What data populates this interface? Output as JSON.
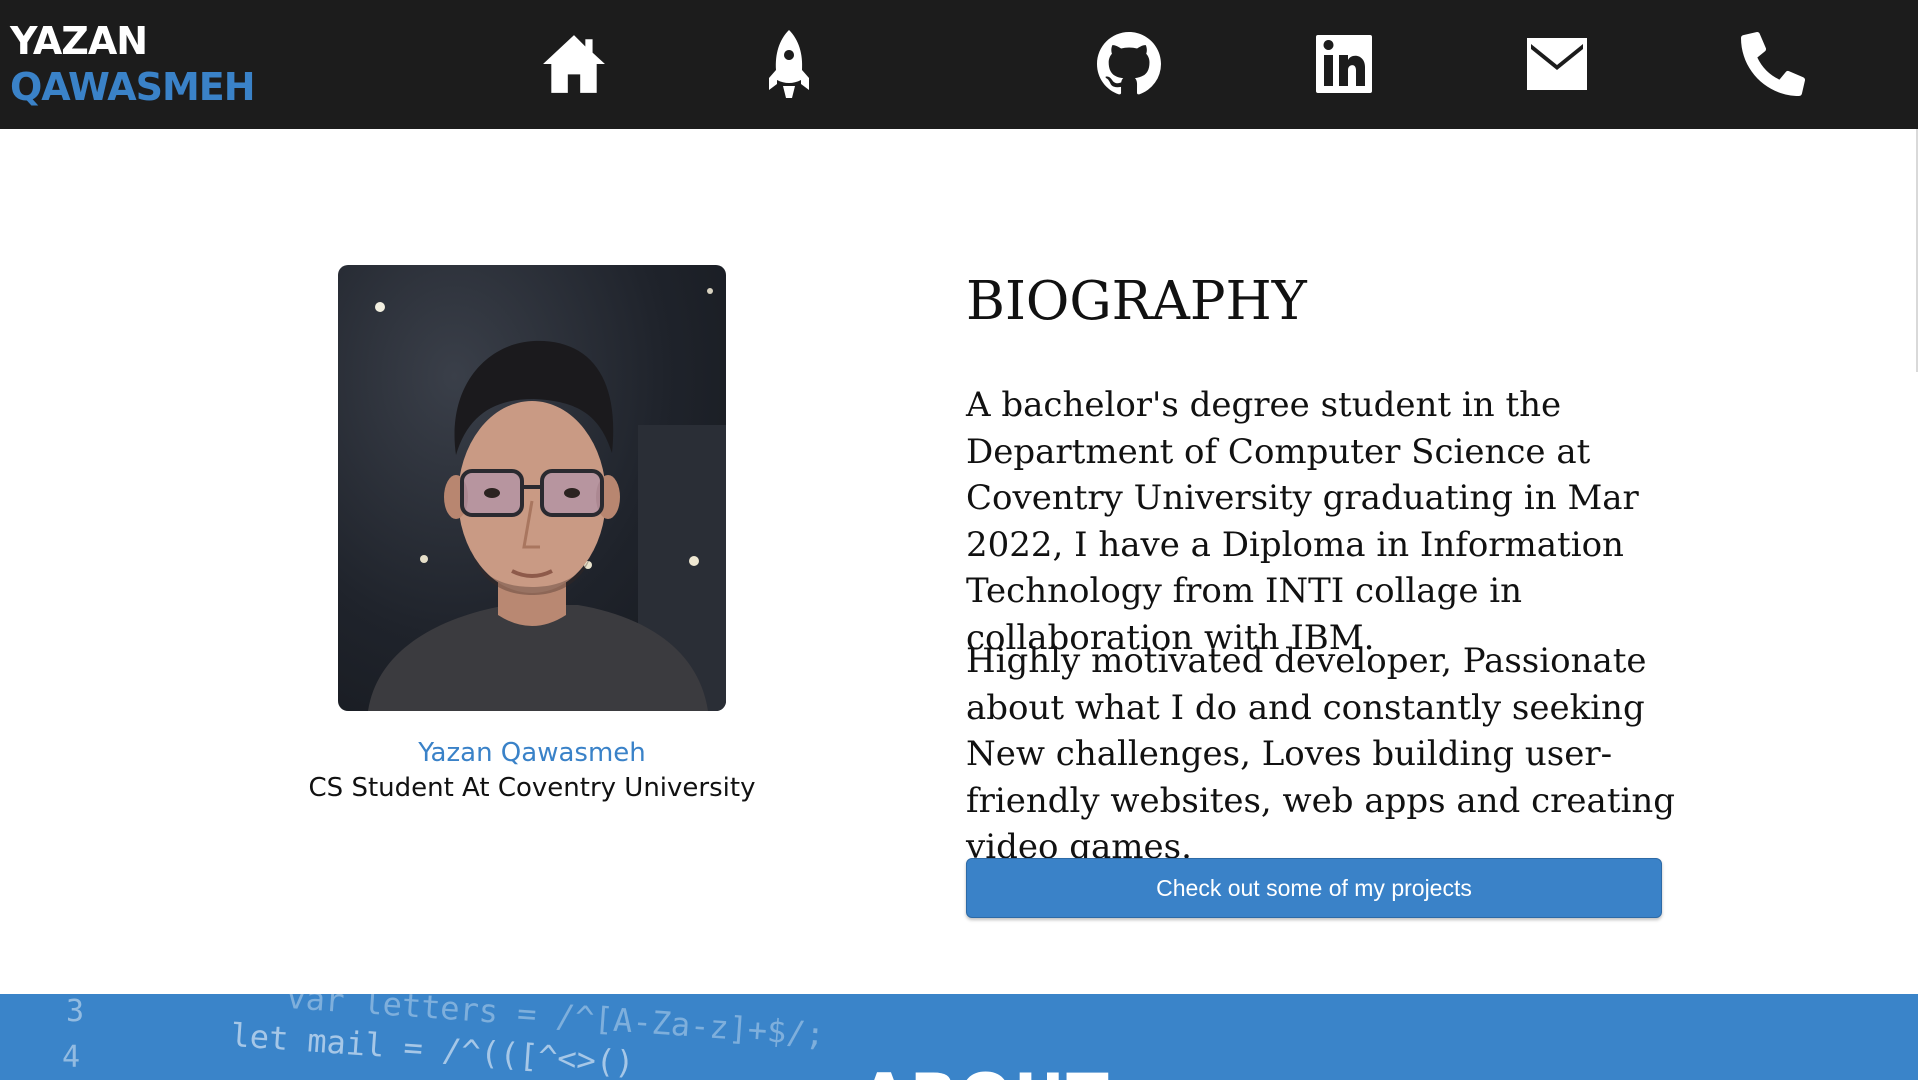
{
  "brand": {
    "first_name": "YAZAN",
    "last_name": "QAWASMEH"
  },
  "nav": {
    "icons": [
      "home-icon",
      "rocket-icon",
      "github-icon",
      "linkedin-icon",
      "mail-icon",
      "phone-icon"
    ]
  },
  "profile": {
    "name": "Yazan Qawasmeh",
    "role": "CS Student At Coventry University"
  },
  "biography": {
    "heading": "BIOGRAPHY",
    "paragraph_1": "A bachelor's degree student in the Department of Computer Science at Coventry University graduating in Mar 2022, I have a Diploma in Information Technology from INTI collage in collaboration with IBM.",
    "paragraph_2": "Highly motivated developer, Passionate about what I do and constantly seeking New challenges, Loves building user-friendly websites, web apps and creating video games.",
    "button_label": "Check out some of my projects"
  },
  "about_band": {
    "title": "ABOUT",
    "code_lines": [
      {
        "number": "3",
        "text": "var letters = /^[A-Za-z]+$/;"
      },
      {
        "number": "4",
        "text": "let mail = /^(([^<>()"
      }
    ]
  },
  "colors": {
    "navbar_bg": "#1c1c1c",
    "accent": "#3a82c8",
    "band_bg": "#3a84c9"
  }
}
